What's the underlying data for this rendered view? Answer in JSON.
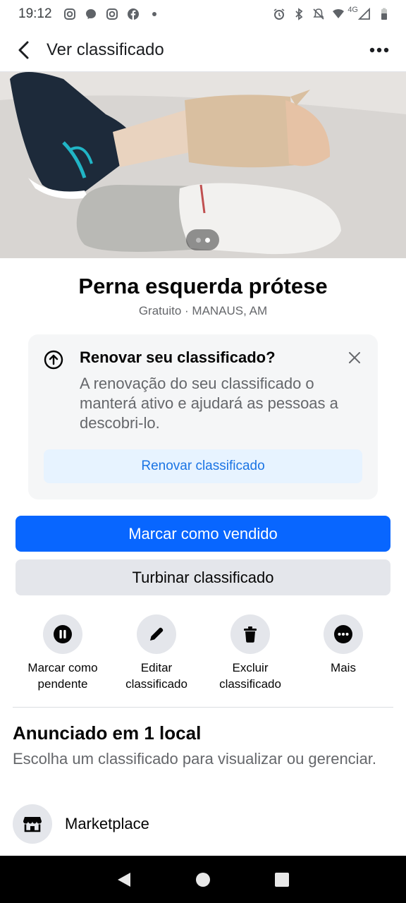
{
  "status_bar": {
    "time": "19:12",
    "network": "4G",
    "left_icons": [
      "instagram-icon",
      "messenger-icon",
      "instagram-icon",
      "facebook-icon",
      "dot-icon"
    ],
    "right_icons": [
      "alarm-icon",
      "bluetooth-icon",
      "mute-icon",
      "wifi-icon",
      "signal-icon",
      "battery-icon"
    ]
  },
  "header": {
    "title": "Ver classificado"
  },
  "photo": {
    "page_count": 2,
    "current_index": 1
  },
  "listing": {
    "title": "Perna esquerda prótese",
    "subtitle": "Gratuito · MANAUS, AM"
  },
  "renew_card": {
    "title": "Renovar seu classificado?",
    "text": "A renovação do seu classificado o manterá ativo e ajudará as pessoas a descobri-lo.",
    "button": "Renovar classificado"
  },
  "buttons": {
    "mark_sold": "Marcar como vendido",
    "boost": "Turbinar classificado"
  },
  "actions": [
    {
      "label_line1": "Marcar como",
      "label_line2": "pendente",
      "icon": "pause-icon"
    },
    {
      "label_line1": "Editar",
      "label_line2": "classificado",
      "icon": "pencil-icon"
    },
    {
      "label_line1": "Excluir",
      "label_line2": "classificado",
      "icon": "trash-icon"
    },
    {
      "label_line1": "Mais",
      "label_line2": "",
      "icon": "more-icon"
    }
  ],
  "listed_section": {
    "title": "Anunciado em 1 local",
    "subtitle": "Escolha um classificado para visualizar ou gerenciar.",
    "places": [
      {
        "label": "Marketplace",
        "icon": "store-icon"
      }
    ]
  },
  "colors": {
    "primary": "#0866ff",
    "link": "#1b74e4",
    "secondary_bg": "#e4e6eb",
    "card_bg": "#f5f6f7"
  }
}
